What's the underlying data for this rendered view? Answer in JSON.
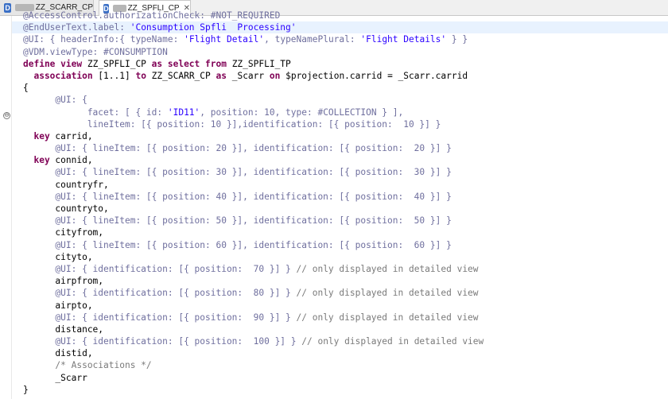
{
  "tabs": [
    {
      "label": "ZZ_SCARR_CP",
      "icon": "ddic-source-icon",
      "active": false
    },
    {
      "label": "ZZ_SPFLI_CP",
      "icon": "ddic-source-icon",
      "active": true,
      "close": "✕"
    }
  ],
  "fold_marker": "⊖",
  "code": {
    "l01": "@AccessControl.authorizationCheck: #NOT_REQUIRED",
    "l02a": "@EndUserText.label: ",
    "l02b": "'Consumption Spfli  Processing'",
    "l03a": "@UI: { headerInfo:{ typeName: ",
    "l03b": "'Flight Detail'",
    "l03c": ", typeNamePlural: ",
    "l03d": "'Flight Details'",
    "l03e": "} }",
    "l04": "@VDM.viewType: #CONSUMPTION",
    "l05a": "define view",
    "l05b": " ZZ_SPFLI_CP ",
    "l05c": "as select from",
    "l05d": " ZZ_SPFLI_TP",
    "l06a": "  association",
    "l06b": " [1..1] ",
    "l06c": "to",
    "l06d": " ZZ_SCARR_CP ",
    "l06e": "as",
    "l06f": " _Scarr ",
    "l06g": "on",
    "l06h": " $projection.carrid = _Scarr.carrid",
    "l07": "{",
    "l08": "      @UI: {",
    "l09a": "            facet: [ { id: ",
    "l09b": "'ID11'",
    "l09c": ", position: 10, type: #COLLECTION } ],",
    "l10": "            lineItem: [{ position: 10 }],identification: [{ position:  10 }] }",
    "l11a": "  key",
    "l11b": " carrid,",
    "l12": "      @UI: { lineItem: [{ position: 20 }], identification: [{ position:  20 }] }",
    "l13a": "  key",
    "l13b": " connid,",
    "l14": "      @UI: { lineItem: [{ position: 30 }], identification: [{ position:  30 }] }",
    "l15": "      countryfr,",
    "l16": "      @UI: { lineItem: [{ position: 40 }], identification: [{ position:  40 }] }",
    "l17": "      countryto,",
    "l18": "      @UI: { lineItem: [{ position: 50 }], identification: [{ position:  50 }] }",
    "l19": "      cityfrom,",
    "l20": "      @UI: { lineItem: [{ position: 60 }], identification: [{ position:  60 }] }",
    "l21": "      cityto,",
    "l22a": "      @UI: { identification: [{ position:  70 }] } ",
    "l22b": "// only displayed in detailed view",
    "l23": "      airpfrom,",
    "l24a": "      @UI: { identification: [{ position:  80 }] } ",
    "l24b": "// only displayed in detailed view",
    "l25": "      airpto,",
    "l26a": "      @UI: { identification: [{ position:  90 }] } ",
    "l26b": "// only displayed in detailed view",
    "l27": "      distance,",
    "l28a": "      @UI: { identification: [{ position:  100 }] } ",
    "l28b": "// only displayed in detailed view",
    "l29": "      distid,",
    "l30": "      /* Associations */",
    "l31": "      _Scarr",
    "l32": "}"
  }
}
